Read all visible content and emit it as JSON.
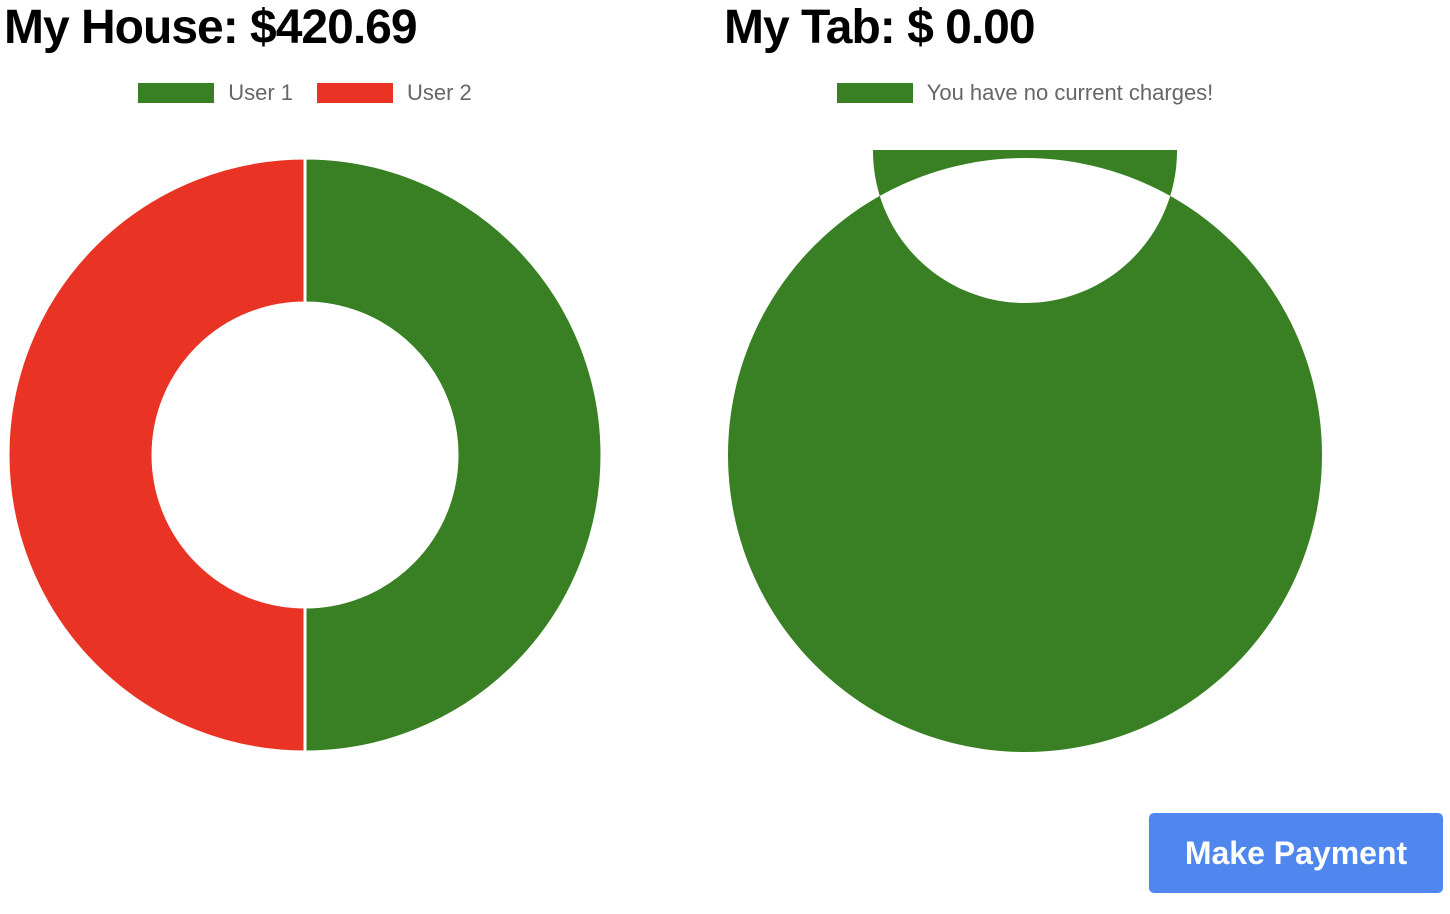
{
  "house": {
    "title": "My House: $420.69",
    "legend": [
      {
        "label": "User 1",
        "color": "#388023"
      },
      {
        "label": "User 2",
        "color": "#e93425"
      }
    ]
  },
  "tab": {
    "title": "My Tab: $ 0.00",
    "legend": [
      {
        "label": "You have no current charges!",
        "color": "#388023"
      }
    ]
  },
  "actions": {
    "make_payment_label": "Make Payment"
  },
  "chart_data": [
    {
      "type": "pie",
      "title": "My House: $420.69",
      "categories": [
        "User 1",
        "User 2"
      ],
      "values": [
        50,
        50
      ],
      "colors": [
        "#388023",
        "#e93425"
      ],
      "legend": "top"
    },
    {
      "type": "pie",
      "title": "My Tab: $ 0.00",
      "categories": [
        "You have no current charges!"
      ],
      "values": [
        100
      ],
      "colors": [
        "#388023"
      ],
      "legend": "top"
    }
  ]
}
